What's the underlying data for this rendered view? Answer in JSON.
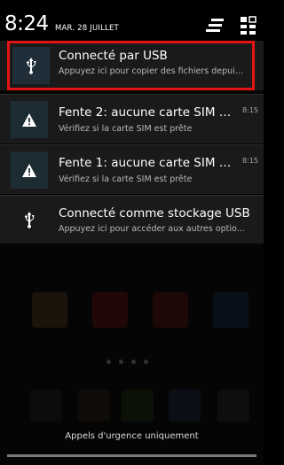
{
  "status_bar": {
    "time": "8:24",
    "date": "MAR. 28 JUILLET",
    "icons": [
      "notification-clear-icon",
      "quick-settings-icon"
    ]
  },
  "notifications": [
    {
      "icon": "usb-icon",
      "title": "Connecté par USB",
      "subtitle": "Appuyez ici pour copier des fichiers depui...",
      "time": "",
      "selected": true
    },
    {
      "icon": "warning-icon",
      "title": "Fente 2: aucune carte SIM dé...",
      "subtitle": "Vérifiez si la carte SIM est prête",
      "time": "8:15",
      "selected": false
    },
    {
      "icon": "warning-icon",
      "title": "Fente 1: aucune carte SIM dé...",
      "subtitle": "Vérifiez si la carte SIM est prête",
      "time": "8:15",
      "selected": false
    },
    {
      "icon": "usb-icon",
      "title": "Connecté comme stockage USB",
      "subtitle": "Appuyez ici pour accéder aux autres optio...",
      "time": "",
      "selected": false
    }
  ],
  "footer": {
    "emergency_text": "Appels d'urgence uniquement"
  },
  "colors": {
    "highlight": "#e31414",
    "icon_box_usb": "#1f2e38",
    "icon_box_warning": "#1d2b33"
  }
}
